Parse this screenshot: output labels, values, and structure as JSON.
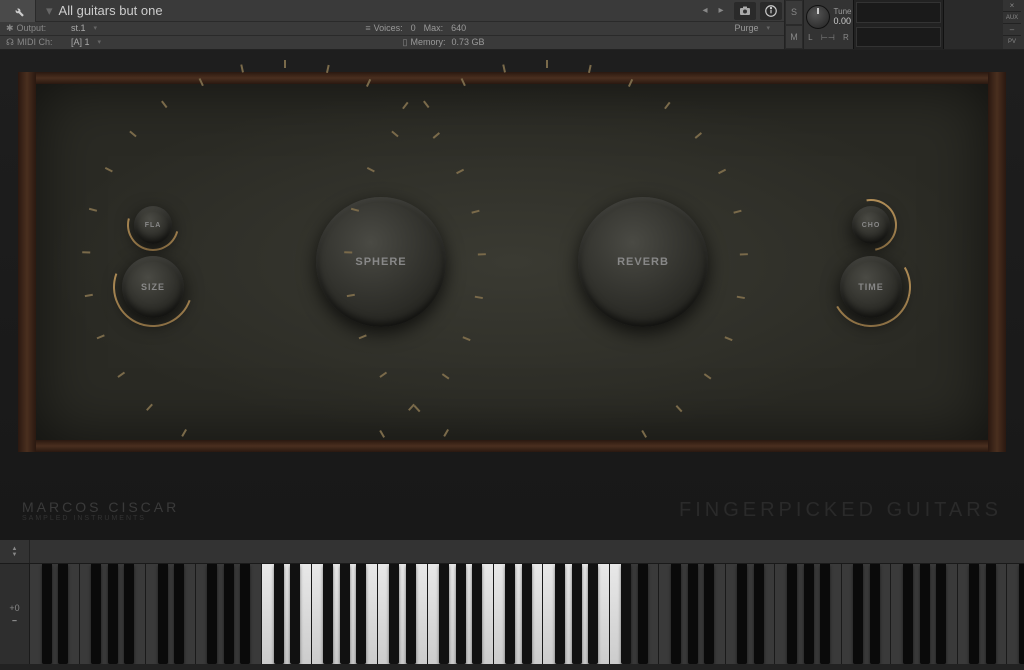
{
  "header": {
    "instrument_name": "All guitars but one",
    "output_label": "Output:",
    "output_value": "st.1",
    "midi_label": "MIDI Ch:",
    "midi_value": "[A] 1",
    "voices_label": "Voices:",
    "voices_value": "0",
    "max_label": "Max:",
    "max_value": "640",
    "memory_label": "Memory:",
    "memory_value": "0.73 GB",
    "purge_label": "Purge",
    "solo_label": "S",
    "mute_label": "M",
    "tune_label": "Tune",
    "tune_value": "0.00",
    "pan_left": "L",
    "pan_right": "R",
    "close_label": "×",
    "aux_label": "AUX",
    "pv_label": "PV"
  },
  "knobs": {
    "fla": "FLA",
    "size": "SIZE",
    "sphere": "SPHERE",
    "reverb": "REVERB",
    "cho": "CHO",
    "time": "TIME"
  },
  "branding": {
    "maker": "MARCOS CISCAR",
    "maker_sub": "SAMPLED INSTRUMENTS",
    "product": "FINGERPICKED GUITARS"
  },
  "keyboard": {
    "pitch_label": "+0",
    "arrow_up": "▲",
    "arrow_down": "▼"
  }
}
